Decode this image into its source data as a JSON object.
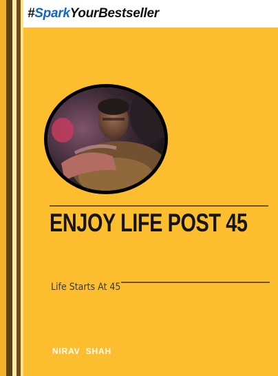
{
  "banner": {
    "hash": "#",
    "spark": "Spark",
    "rest": "YourBestseller"
  },
  "cover": {
    "title": "ENJOY LIFE POST 45",
    "subtitle": "Life Starts At 45",
    "author": "NIRAV  SHAH"
  },
  "colors": {
    "background": "#FCBE2E",
    "banner": "#FFFFFF",
    "spark_blue": "#1565C0",
    "title": "#151515",
    "author": "#FFFFFF"
  },
  "photo": {
    "shape": "circle",
    "border": "#000000"
  }
}
